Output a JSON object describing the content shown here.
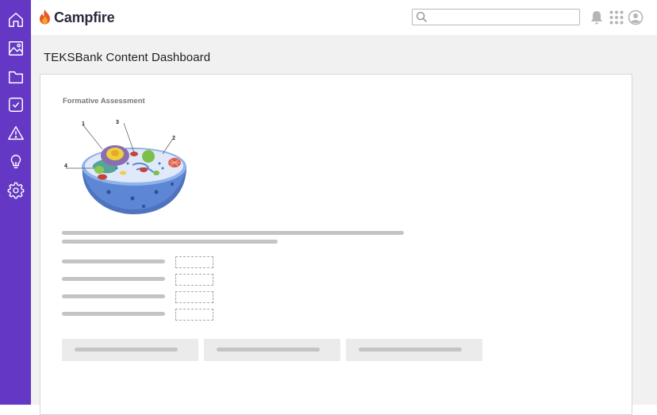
{
  "app": {
    "name": "Campfire",
    "brand_color": "#6438c4",
    "logo_color": "#e8582a"
  },
  "sidebar": {
    "items": [
      {
        "name": "home",
        "icon": "home-icon"
      },
      {
        "name": "media",
        "icon": "image-icon"
      },
      {
        "name": "folders",
        "icon": "folder-icon"
      },
      {
        "name": "tasks",
        "icon": "checkbox-icon"
      },
      {
        "name": "alerts",
        "icon": "warning-icon"
      },
      {
        "name": "ideas",
        "icon": "lightbulb-icon"
      },
      {
        "name": "settings",
        "icon": "gear-icon"
      }
    ]
  },
  "header": {
    "search": {
      "placeholder": "",
      "value": ""
    },
    "icons": [
      "bell-icon",
      "apps-grid-icon",
      "user-avatar-icon"
    ]
  },
  "page": {
    "title": "TEKSBank Content Dashboard"
  },
  "card": {
    "heading": "Formative Assessment",
    "figure": {
      "icon": "animal-cell-diagram",
      "labels": [
        "1",
        "3",
        "2",
        "4"
      ]
    },
    "matching_rows": 4,
    "answer_choices": 3
  }
}
